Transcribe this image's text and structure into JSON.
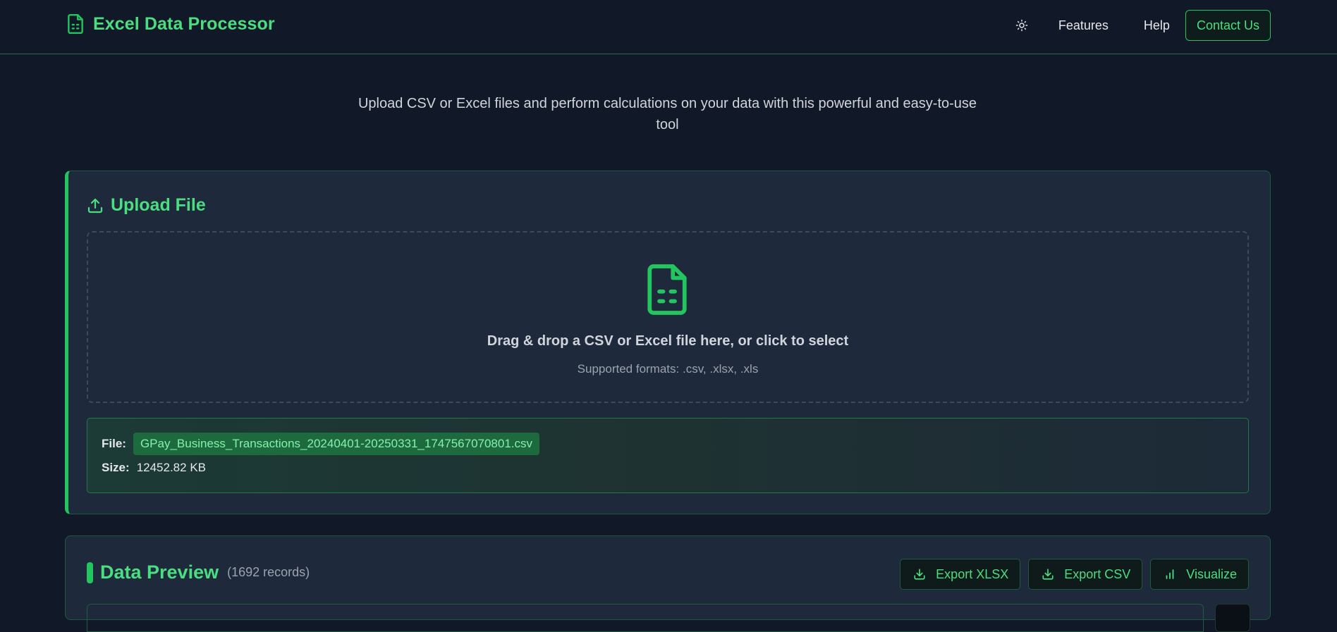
{
  "header": {
    "brand_title": "Excel Data Processor",
    "brand_icon": "file-spreadsheet-icon",
    "theme_icon": "sun-icon",
    "nav_features": "Features",
    "nav_help": "Help",
    "contact_label": "Contact Us"
  },
  "tagline": "Upload CSV or Excel files and perform calculations on your data with this powerful and easy-to-use tool",
  "upload": {
    "title": "Upload File",
    "title_icon": "upload-icon",
    "dropzone_icon": "file-spreadsheet-icon",
    "dropzone_text": "Drag & drop a CSV or Excel file here, or click to select",
    "supported_formats": "Supported formats: .csv, .xlsx, .xls",
    "file_label": "File:",
    "file_name": "GPay_Business_Transactions_20240401-20250331_1747567070801.csv",
    "size_label": "Size:",
    "file_size": "12452.82 KB"
  },
  "preview": {
    "title": "Data Preview",
    "record_count": "(1692 records)",
    "export_xlsx_label": "Export XLSX",
    "export_csv_label": "Export CSV",
    "visualize_label": "Visualize",
    "download_icon": "download-icon",
    "chart_icon": "bar-chart-icon"
  },
  "colors": {
    "accent": "#4ade80",
    "accent_strong": "#22c55e",
    "background": "#111827",
    "card": "#1e293b"
  }
}
